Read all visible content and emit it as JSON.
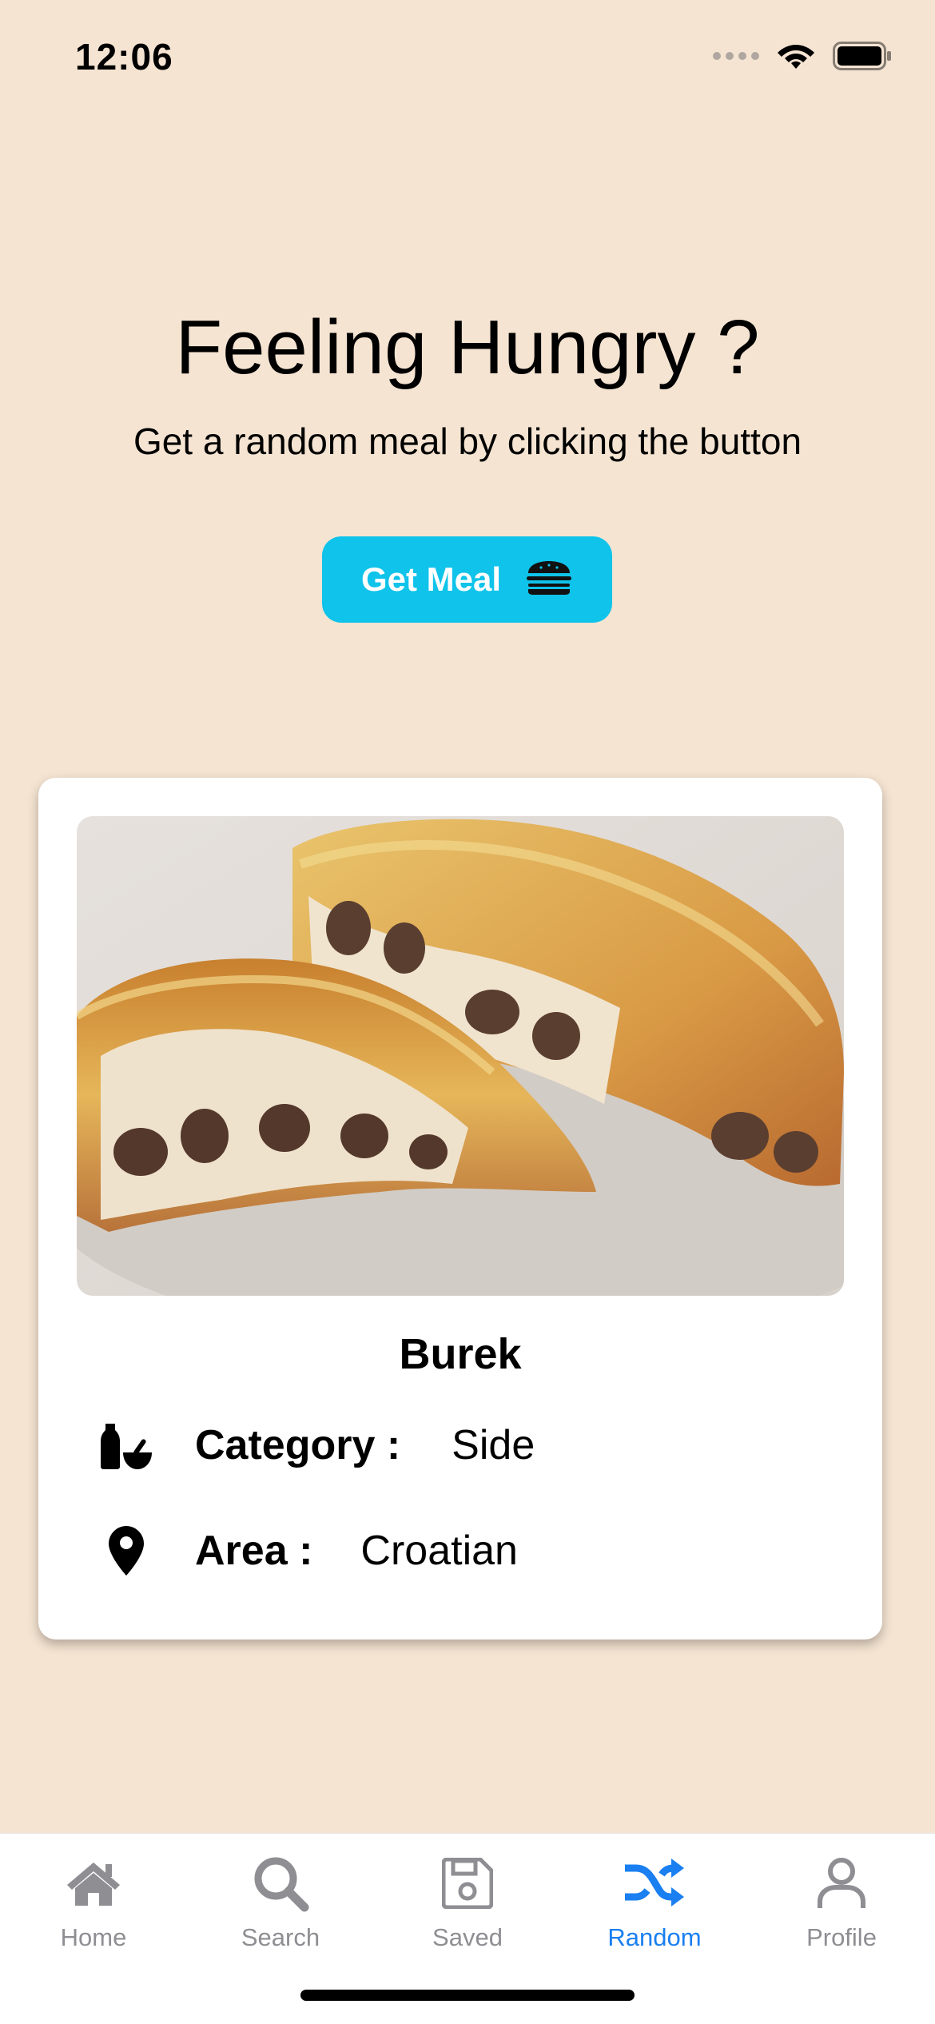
{
  "status_bar": {
    "time": "12:06"
  },
  "hero": {
    "title": "Feeling Hungry ?",
    "subtitle": "Get a random meal by clicking the button",
    "button_label": "Get Meal"
  },
  "meal": {
    "name": "Burek",
    "category_label": "Category :",
    "category_value": "Side",
    "area_label": "Area :",
    "area_value": "Croatian"
  },
  "tabs": [
    {
      "label": "Home",
      "icon": "home-icon",
      "active": false
    },
    {
      "label": "Search",
      "icon": "search-icon",
      "active": false
    },
    {
      "label": "Saved",
      "icon": "save-icon",
      "active": false
    },
    {
      "label": "Random",
      "icon": "shuffle-icon",
      "active": true
    },
    {
      "label": "Profile",
      "icon": "user-icon",
      "active": false
    }
  ],
  "colors": {
    "background": "#f5e4d2",
    "button": "#0fc3ea",
    "active_tab": "#1a7ff0",
    "inactive_tab": "#8e8e93"
  }
}
